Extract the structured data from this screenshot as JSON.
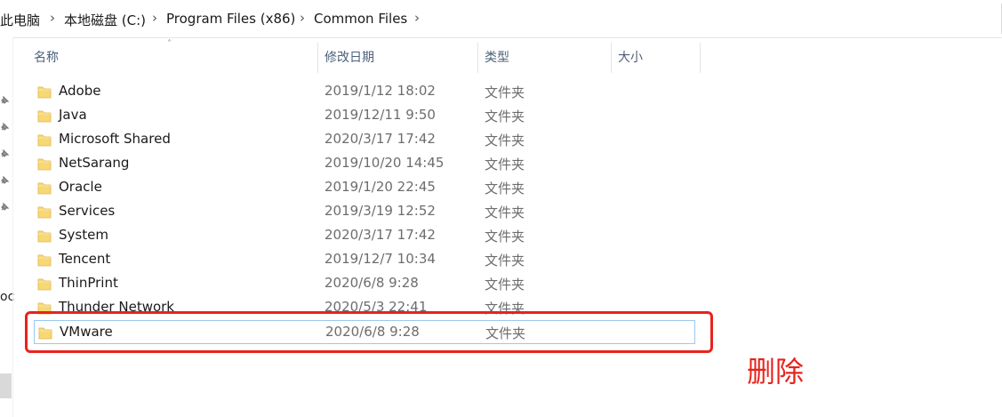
{
  "breadcrumb": [
    "此电脑",
    "本地磁盘 (C:)",
    "Program Files (x86)",
    "Common Files"
  ],
  "columns": {
    "name": "名称",
    "date": "修改日期",
    "type": "类型",
    "size": "大小"
  },
  "left_nav": {
    "truncated_label": "oc"
  },
  "files": [
    {
      "name": "Adobe",
      "date": "2019/1/12 18:02",
      "type": "文件夹"
    },
    {
      "name": "Java",
      "date": "2019/12/11 9:50",
      "type": "文件夹"
    },
    {
      "name": "Microsoft Shared",
      "date": "2020/3/17 17:42",
      "type": "文件夹"
    },
    {
      "name": "NetSarang",
      "date": "2019/10/20 14:45",
      "type": "文件夹"
    },
    {
      "name": "Oracle",
      "date": "2019/1/20 22:45",
      "type": "文件夹"
    },
    {
      "name": "Services",
      "date": "2019/3/19 12:52",
      "type": "文件夹"
    },
    {
      "name": "System",
      "date": "2020/3/17 17:42",
      "type": "文件夹"
    },
    {
      "name": "Tencent",
      "date": "2019/12/7 10:34",
      "type": "文件夹"
    },
    {
      "name": "ThinPrint",
      "date": "2020/6/8 9:28",
      "type": "文件夹"
    },
    {
      "name": "Thunder Network",
      "date": "2020/5/3 22:41",
      "type": "文件夹"
    },
    {
      "name": "VMware",
      "date": "2020/6/8 9:28",
      "type": "文件夹"
    }
  ],
  "annotation": "删除",
  "colors": {
    "folder": "#f8d775",
    "highlight": "#e8231c",
    "selection_border": "#99c9ef"
  }
}
